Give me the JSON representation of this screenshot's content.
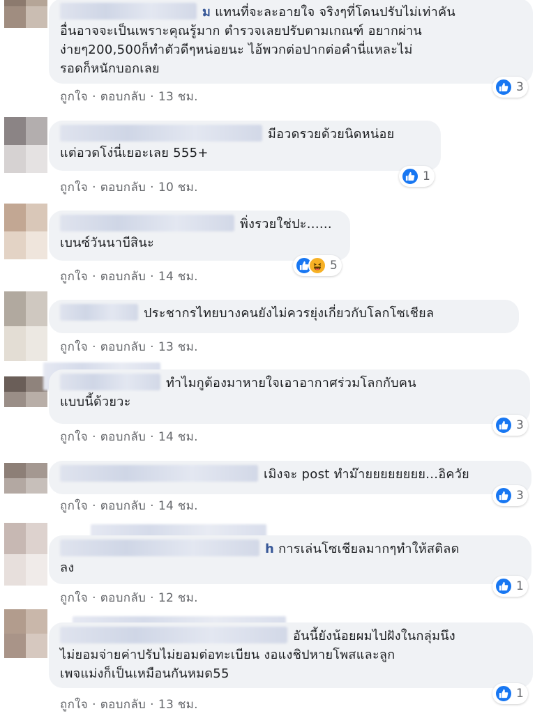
{
  "actions": {
    "like": "ถูกใจ",
    "reply": "ตอบกลับ",
    "separator": "·"
  },
  "colors": {
    "like_blue": "#1877f2",
    "bubble_bg": "#f0f2f5",
    "meta_gray": "#65676b",
    "haha_yellow": "#f7b125"
  },
  "comments": [
    {
      "name_tail": "ม",
      "line1": "แทนที่จะละอายใจ จริงๆที่โดนปรับไม่เท่าคัน",
      "line2": "อื่นอาจจะเป็นเพราะคุณรู้มาก ตำรวจเลยปรับตามเกณฑ์ อยากผ่าน",
      "line3": "ง่ายๆ200,500ก็ทำตัวดีๆหน่อยนะ ไอ้พวกต่อปากต่อคำนี่แหละไม่",
      "line4": "รอดก็หนักบอกเลย",
      "time": "13 ชม.",
      "reactions": {
        "count": "3",
        "types": [
          "like"
        ]
      }
    },
    {
      "name_tail": "",
      "line1": "มีอวดรวยด้วยนิดหน่อย",
      "line2": "แต่อวดโง่นี่เยอะเลย 555+",
      "time": "10 ชม.",
      "reactions": {
        "count": "1",
        "types": [
          "like"
        ]
      }
    },
    {
      "name_tail": "",
      "line1": "พิ่งรวยใช่ปะ......",
      "line2": "เบนซ์วันนาบีสินะ",
      "time": "14 ชม.",
      "reactions": {
        "count": "5",
        "types": [
          "like",
          "haha"
        ]
      }
    },
    {
      "name_tail": "",
      "line1": "ประชากรไทยบางคนยังไม่ควรยุ่งเกี่ยวกับโลกโซเชียล",
      "time": "13 ชม."
    },
    {
      "name_tail": "",
      "line1": "ทำไมกูต้องมาหายใจเอาอากาศร่วมโลกกับคน",
      "line2": "แบบนี้ด้วยวะ",
      "time": "14 ชม.",
      "reactions": {
        "count": "3",
        "types": [
          "like"
        ]
      }
    },
    {
      "name_tail": "",
      "line1": "เมิงจะ post ทำม๊ายยยยยยยย...อิควัย",
      "time": "14 ชม.",
      "reactions": {
        "count": "3",
        "types": [
          "like"
        ]
      }
    },
    {
      "name_tail": "h",
      "line1": "การเล่นโซเชียลมากๆทำให้สติลด",
      "line2": "ลง",
      "time": "12 ชม.",
      "reactions": {
        "count": "1",
        "types": [
          "like"
        ]
      }
    },
    {
      "name_tail": "",
      "line1": "อันนี้ยังน้อยผมไปฝังในกลุ่มนึง",
      "line2": "ไม่ยอมจ่ายค่าปรับไม่ยอมต่อทะเบียน งอแงชิปหายโพสและลูก",
      "line3": "เพจแม่งก็เป็นเหมือนกันหมด55",
      "time": "13 ชม.",
      "reactions": {
        "count": "1",
        "types": [
          "like"
        ]
      }
    }
  ]
}
